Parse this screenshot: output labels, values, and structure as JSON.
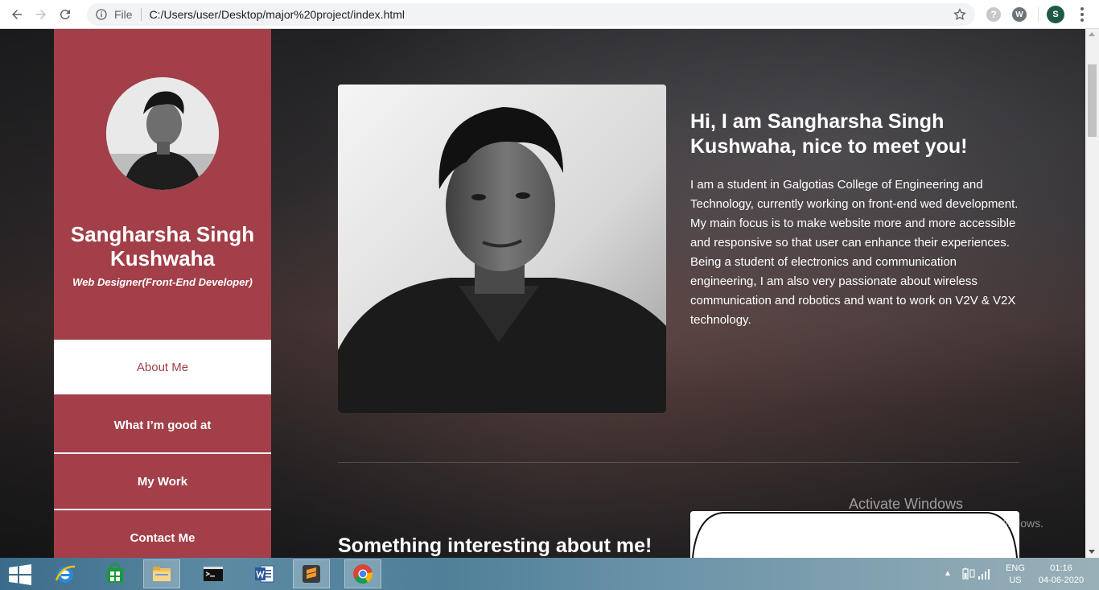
{
  "browser": {
    "scheme_label": "File",
    "url": "C:/Users/user/Desktop/major%20project/index.html",
    "profile_initial": "S",
    "ext1_label": "?",
    "ext2_label": "W"
  },
  "sidebar": {
    "name": "Sangharsha Singh Kushwaha",
    "role": "Web Designer(Front-End Developer)",
    "menu": [
      {
        "label": "About Me",
        "active": true
      },
      {
        "label": "What I’m good at"
      },
      {
        "label": "My Work"
      },
      {
        "label": "Contact Me"
      }
    ]
  },
  "main": {
    "intro_title": "Hi, I am Sangharsha Singh Kushwaha, nice to meet you!",
    "intro_p1": "I am a student in Galgotias College of Engineering and Technology, currently working on front-end wed development. My main focus is to make website more and more accessible and responsive so that user can enhance their experiences.",
    "intro_p2": "Being a student of electronics and communication engineering, I am also very passionate about wireless communication and robotics and want to work on V2V & V2X technology.",
    "section2_title": "Something interesting about me!"
  },
  "watermark": {
    "title": "Activate Windows",
    "subtitle": "Go to PC settings to activate Windows."
  },
  "taskbar": {
    "lang_top": "ENG",
    "lang_bottom": "US",
    "time": "01:16",
    "date": "04-06-2020",
    "apps": [
      "internet-explorer",
      "store",
      "file-explorer",
      "command-prompt",
      "word",
      "sublime-text",
      "chrome"
    ]
  },
  "colors": {
    "sidebar": "#a23f49",
    "active_text": "#a23f49"
  }
}
